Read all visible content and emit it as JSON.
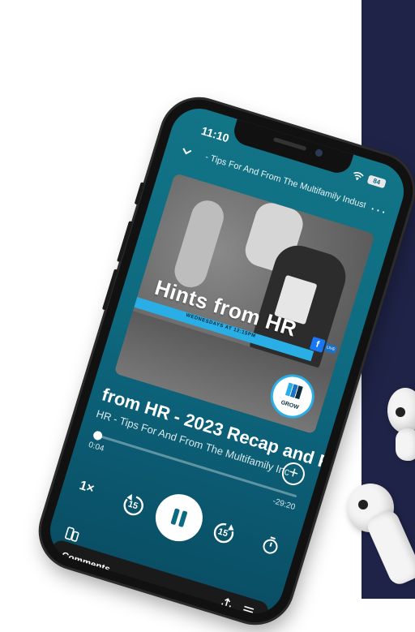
{
  "status_bar": {
    "time": "11:10",
    "battery": "84"
  },
  "header": {
    "episode_title": "- Tips For And From The Multifamily Industr"
  },
  "artwork": {
    "title": "Hints from HR",
    "band_text": "WEDNESDAYS AT 12:15PM",
    "fb": "f",
    "live": "LIVE",
    "badge_text": "GROW"
  },
  "track": {
    "title": "from HR - 2023 Recap and Fo",
    "subtitle": "HR - Tips For And From The Multifamily Inc"
  },
  "playback": {
    "elapsed": "0:04",
    "remaining": "-29:20",
    "progress": 0.02,
    "speed": "1×",
    "skip_back": "15",
    "skip_forward": "15"
  },
  "bottom": {
    "comments_label": "Comments"
  },
  "colors": {
    "accent": "#0e6a80",
    "panel": "#1f2347"
  }
}
